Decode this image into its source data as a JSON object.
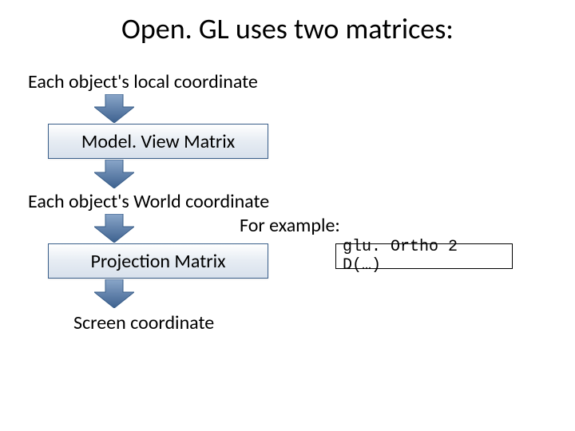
{
  "title": "Open. GL uses two matrices:",
  "stages": {
    "local": "Each object's local coordinate",
    "world": "Each object's World coordinate",
    "screen": "Screen coordinate"
  },
  "matrices": {
    "modelview": "Model. View Matrix",
    "projection": "Projection Matrix"
  },
  "example": {
    "label": "For example:",
    "code": "glu. Ortho 2 D(…)"
  },
  "arrow_color": "#5a7fb0"
}
